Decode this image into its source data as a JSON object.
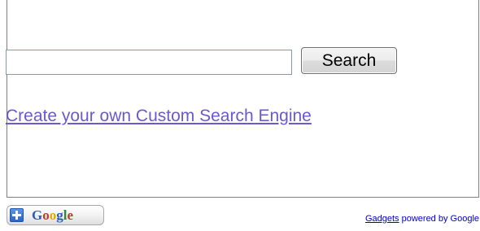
{
  "search": {
    "value": "",
    "placeholder": "",
    "button_label": "Search"
  },
  "cse_link": {
    "label": "Create your own Custom Search Engine"
  },
  "add_to_google": {
    "logo_text": "Google",
    "icon": "plus-icon"
  },
  "footer": {
    "gadgets_link": "Gadgets",
    "powered_by": " powered by Google"
  },
  "colors": {
    "link": "#6a5acd",
    "footer_link": "#0000cc",
    "border": "#7f7f7f",
    "input_border": "#7f9db9"
  }
}
